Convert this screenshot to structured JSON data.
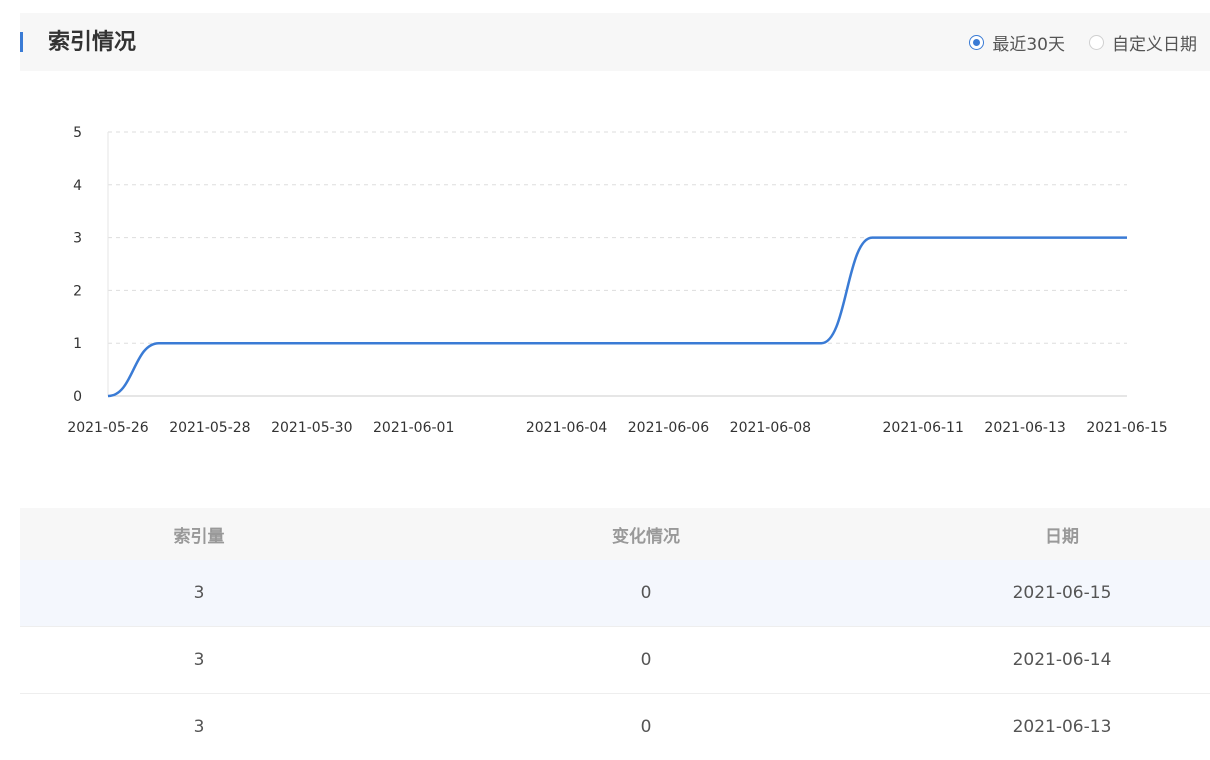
{
  "header": {
    "title": "索引情况",
    "radios": [
      {
        "label": "最近30天",
        "checked": true
      },
      {
        "label": "自定义日期",
        "checked": false
      }
    ]
  },
  "colors": {
    "accent": "#3a7bd5",
    "line": "#3a7bd5",
    "grid": "#dddddd"
  },
  "chart_data": {
    "type": "line",
    "x": [
      "2021-05-26",
      "2021-05-27",
      "2021-05-28",
      "2021-05-29",
      "2021-05-30",
      "2021-05-31",
      "2021-06-01",
      "2021-06-02",
      "2021-06-03",
      "2021-06-04",
      "2021-06-05",
      "2021-06-06",
      "2021-06-07",
      "2021-06-08",
      "2021-06-09",
      "2021-06-10",
      "2021-06-11",
      "2021-06-12",
      "2021-06-13",
      "2021-06-14",
      "2021-06-15"
    ],
    "values": [
      0,
      1,
      1,
      1,
      1,
      1,
      1,
      1,
      1,
      1,
      1,
      1,
      1,
      1,
      1,
      3,
      3,
      3,
      3,
      3,
      3
    ],
    "x_tick_labels": [
      "2021-05-26",
      "2021-05-28",
      "2021-05-30",
      "2021-06-01",
      "2021-06-04",
      "2021-06-06",
      "2021-06-08",
      "2021-06-11",
      "2021-06-13",
      "2021-06-15"
    ],
    "y_ticks": [
      0,
      1,
      2,
      3,
      4,
      5
    ],
    "ylim": [
      0,
      5
    ],
    "grid": true,
    "smooth": true
  },
  "table": {
    "headers": [
      "索引量",
      "变化情况",
      "日期"
    ],
    "rows": [
      {
        "count": "3",
        "change": "0",
        "date": "2021-06-15"
      },
      {
        "count": "3",
        "change": "0",
        "date": "2021-06-14"
      },
      {
        "count": "3",
        "change": "0",
        "date": "2021-06-13"
      }
    ]
  }
}
